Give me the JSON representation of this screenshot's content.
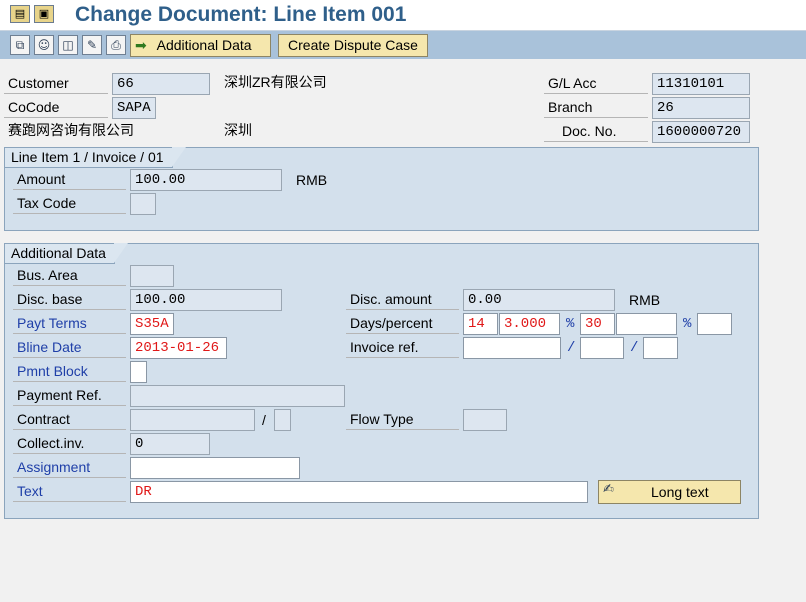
{
  "window": {
    "title": "Change Document: Line Item 001"
  },
  "toolbar": {
    "additional_data": "Additional Data",
    "create_dispute_case": "Create Dispute Case"
  },
  "header": {
    "customer_label": "Customer",
    "customer_value": "66",
    "customer_name": "深圳ZR有限公司",
    "cocode_label": "CoCode",
    "cocode_value": "SAPA",
    "company_name": "赛跑网咨询有限公司",
    "city": "深圳",
    "gl_label": "G/L Acc",
    "gl_value": "11310101",
    "branch_label": "Branch",
    "branch_value": "26",
    "docno_label": "Doc. No.",
    "docno_value": "1600000720"
  },
  "line_item": {
    "title": "Line Item 1 / Invoice / 01",
    "amount_label": "Amount",
    "amount_value": "100.00",
    "currency": "RMB",
    "taxcode_label": "Tax Code",
    "taxcode_value": ""
  },
  "additional": {
    "title": "Additional Data",
    "bus_area_label": "Bus. Area",
    "bus_area_value": "",
    "disc_base_label": "Disc. base",
    "disc_base_value": "100.00",
    "disc_amount_label": "Disc. amount",
    "disc_amount_value": "0.00",
    "currency": "RMB",
    "payt_terms_label": "Payt Terms",
    "payt_terms_value": "S35A",
    "days_percent_label": "Days/percent",
    "days1": "14",
    "pct1": "3.000",
    "days2": "30",
    "pct2": "",
    "percent_symbol": "%",
    "bline_date_label": "Bline Date",
    "bline_date_value": "2013-01-26",
    "invoice_ref_label": "Invoice ref.",
    "invoice_ref_value": "",
    "invoice_ref_2": "",
    "invoice_ref_3": "",
    "slash": "/",
    "pmnt_block_label": "Pmnt Block",
    "pmnt_block_value": "",
    "payment_ref_label": "Payment Ref.",
    "payment_ref_value": "",
    "contract_label": "Contract",
    "contract_value": "",
    "contract_2": "",
    "flow_type_label": "Flow Type",
    "flow_type_value": "",
    "collect_inv_label": "Collect.inv.",
    "collect_inv_value": "0",
    "assignment_label": "Assignment",
    "assignment_value": "",
    "text_label": "Text",
    "text_value": "DR",
    "long_text_label": "Long text"
  },
  "colors": {
    "title": "#2f5f8a",
    "toolbar": "#a9c2da",
    "group_bg": "#d3e0ec",
    "required_value": "#e01818",
    "link_label": "#1f3fa8",
    "button": "#f5e7ad"
  },
  "icons": [
    "menu-icon",
    "exit-icon",
    "select-document-icon",
    "customer-icon",
    "display-document-icon",
    "change-document-icon",
    "print-icon",
    "back-arrow-icon",
    "long-text-icon"
  ]
}
